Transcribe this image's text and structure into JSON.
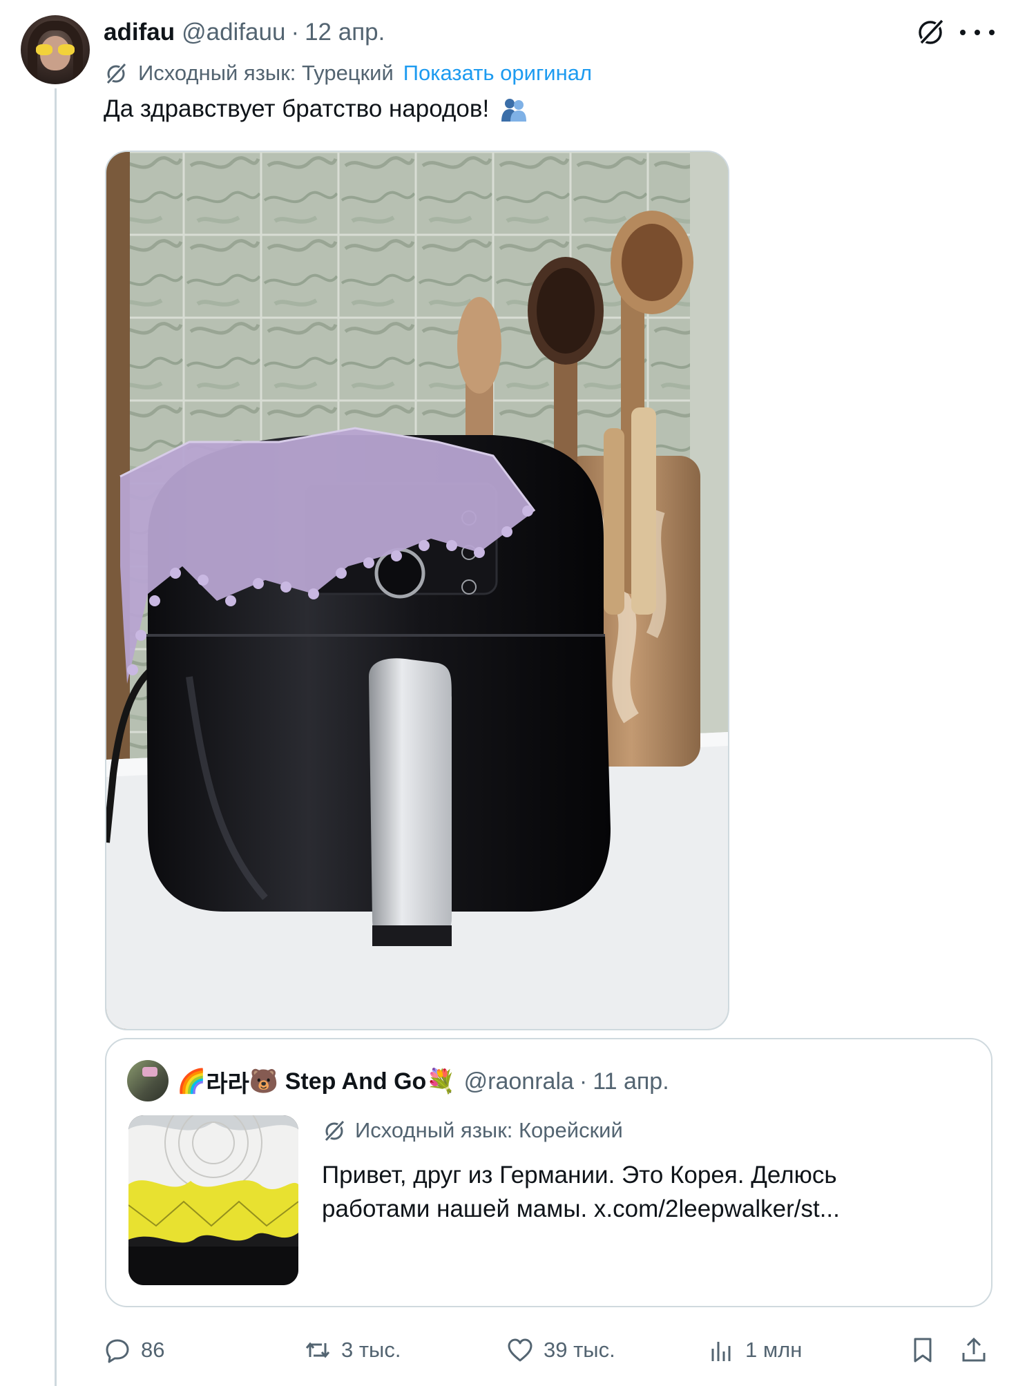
{
  "author": {
    "name": "adifau",
    "handle": "@adifauu",
    "separator": "·",
    "date": "12 апр."
  },
  "translation": {
    "source_label": "Исходный язык: Турецкий",
    "show_original": "Показать оригинал"
  },
  "tweet": {
    "text": "Да здравствует братство народов!"
  },
  "quote": {
    "name": "🌈라라🐻 Step And Go💐",
    "name_prefix_emoji": "🌈",
    "name_korean": "라라",
    "name_bear_emoji": "🐻",
    "name_main": " Step And Go",
    "name_flower_emoji": "💐",
    "handle": "@raonrala",
    "separator": "·",
    "date": "11 апр.",
    "source_label": "Исходный язык: Корейский",
    "text_line1": "Привет, друг из Германии. Это Корея. Делюсь",
    "text_line2": "работами нашей мамы. x.com/2leepwalker/st..."
  },
  "actions": {
    "replies": "86",
    "reposts": "3 тыс.",
    "likes": "39 тыс.",
    "views": "1 млн"
  },
  "colors": {
    "accent": "#1d9bf0",
    "secondary_text": "#536471",
    "border": "#cfd9de"
  },
  "icons": [
    "grok-icon",
    "more-icon",
    "translate-icon",
    "people-hugging-emoji",
    "reply-icon",
    "repost-icon",
    "like-icon",
    "views-icon",
    "bookmark-icon",
    "share-icon"
  ]
}
